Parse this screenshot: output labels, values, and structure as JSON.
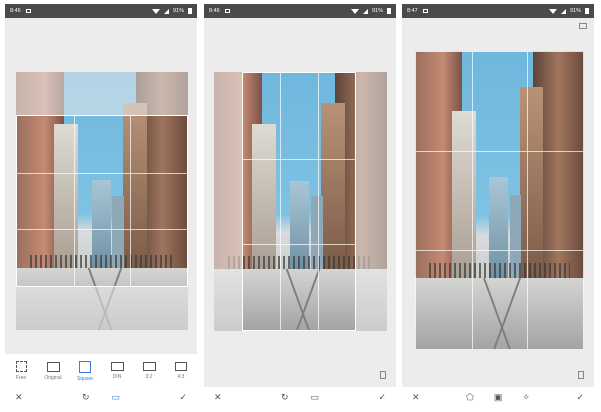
{
  "colors": {
    "accent": "#3b7de0",
    "status_bar": "#4a4a4a",
    "canvas_bg": "#ececec"
  },
  "screens": [
    {
      "status": {
        "time": "8:46",
        "battery": "91%"
      },
      "aspect_options": [
        {
          "label": "Free",
          "icon": "free-crop-icon"
        },
        {
          "label": "Original",
          "icon": "image-icon"
        },
        {
          "label": "Square",
          "icon": "square-icon",
          "selected": true
        },
        {
          "label": "DIN",
          "icon": "din-icon"
        },
        {
          "label": "3:2",
          "icon": "ratio-3-2-icon"
        },
        {
          "label": "4:3",
          "icon": "ratio-4-3-icon"
        }
      ],
      "toolbar": {
        "cancel": "✕",
        "rotate": "↻",
        "aspect": "▭",
        "apply": "✓"
      }
    },
    {
      "status": {
        "time": "8:46",
        "battery": "91%"
      },
      "toolbar": {
        "cancel": "✕",
        "rotate": "↻",
        "aspect": "▭",
        "apply": "✓"
      }
    },
    {
      "status": {
        "time": "8:47",
        "battery": "91%"
      },
      "toolbar": {
        "cancel": "✕",
        "perspective": "⬠",
        "expand": "▣",
        "auto": "✧",
        "apply": "✓"
      }
    }
  ]
}
